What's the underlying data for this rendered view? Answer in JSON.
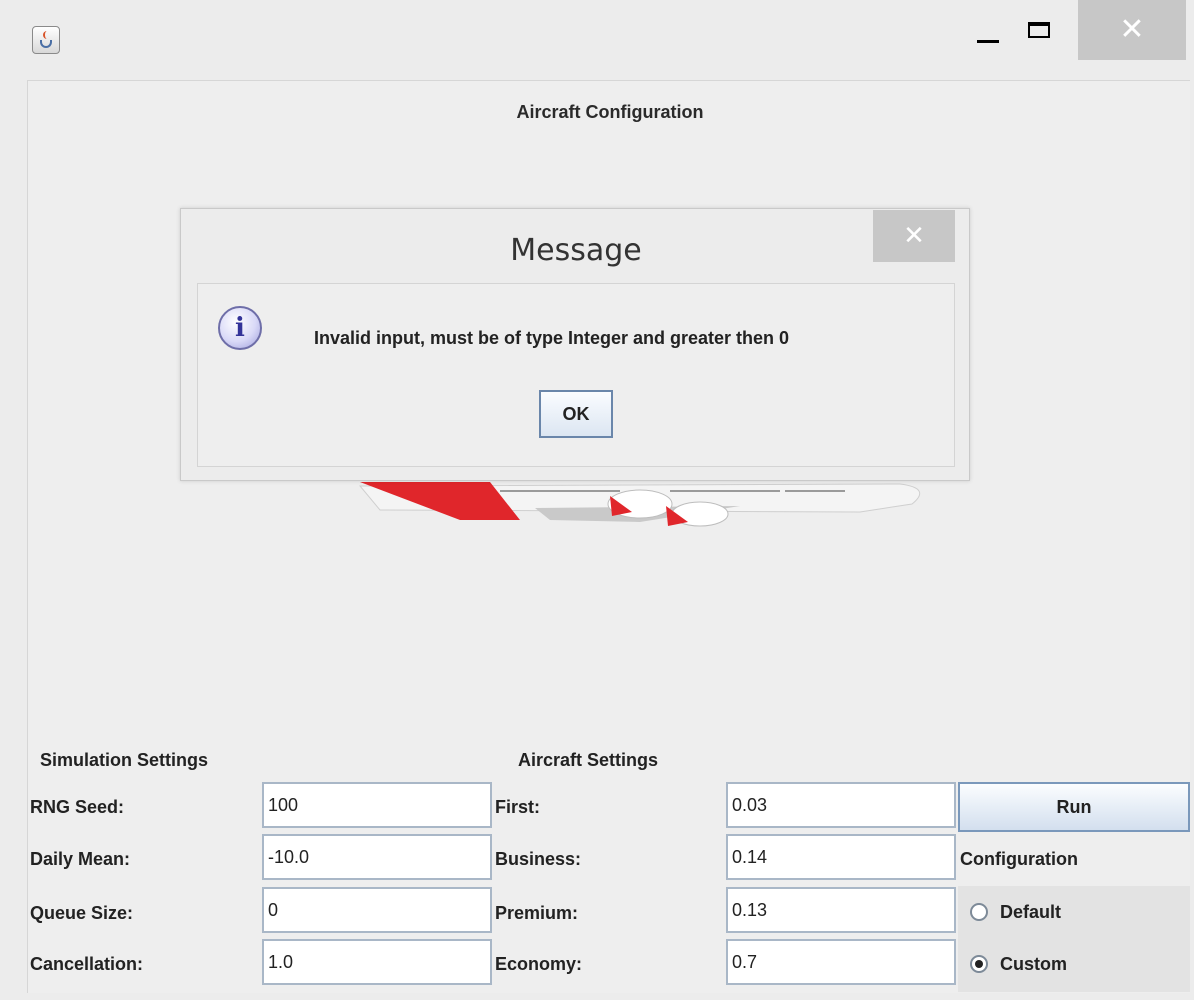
{
  "window": {
    "title": "",
    "close_glyph": "✕"
  },
  "main": {
    "title": "Aircraft Configuration"
  },
  "dialog": {
    "title": "Message",
    "message": "Invalid input, must be of type Integer and greater then 0",
    "ok_label": "OK",
    "close_glyph": "✕",
    "icon_glyph": "i"
  },
  "simulation": {
    "heading": "Simulation Settings",
    "fields": [
      {
        "label": "RNG Seed:",
        "value": "100"
      },
      {
        "label": "Daily Mean:",
        "value": "-10.0"
      },
      {
        "label": "Queue Size:",
        "value": "0"
      },
      {
        "label": "Cancellation:",
        "value": "1.0"
      }
    ]
  },
  "aircraft": {
    "heading": "Aircraft Settings",
    "fields": [
      {
        "label": "First:",
        "value": "0.03"
      },
      {
        "label": "Business:",
        "value": "0.14"
      },
      {
        "label": "Premium:",
        "value": "0.13"
      },
      {
        "label": "Economy:",
        "value": "0.7"
      }
    ]
  },
  "actions": {
    "run_label": "Run",
    "configuration_label": "Configuration",
    "options": [
      {
        "label": "Default",
        "selected": false
      },
      {
        "label": "Custom",
        "selected": true
      }
    ]
  },
  "colors": {
    "airline_red": "#e0262b",
    "fuselage": "#f4f4f4"
  }
}
